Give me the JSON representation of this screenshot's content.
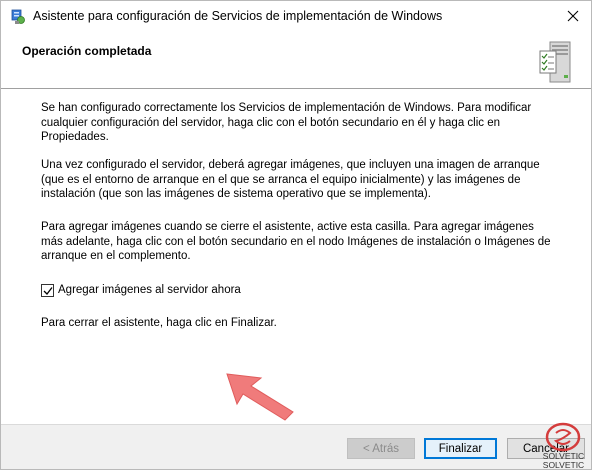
{
  "window": {
    "title": "Asistente para configuración de Servicios de implementación de Windows"
  },
  "header": {
    "title": "Operación completada",
    "icon": "server-checklist-icon"
  },
  "content": {
    "paragraph_1": "Se han configurado correctamente los Servicios de implementación de Windows. Para modificar cualquier configuración del servidor, haga clic con el botón secundario en él y haga clic en Propiedades.",
    "paragraph_2": "Una vez configurado el servidor, deberá agregar imágenes, que incluyen una imagen de arranque (que es el entorno de arranque en el que se arranca el equipo inicialmente) y las imágenes de instalación (que son las imágenes de sistema operativo que se implementa).",
    "paragraph_3": "Para agregar imágenes cuando se cierre el asistente, active esta casilla. Para agregar imágenes más adelante, haga clic con el botón secundario en el nodo Imágenes de instalación o Imágenes de arranque en el complemento.",
    "checkbox_label": "Agregar imágenes al servidor ahora",
    "checkbox_checked": true,
    "paragraph_4": "Para cerrar el asistente, haga clic en Finalizar."
  },
  "footer": {
    "back_label": "< Atrás",
    "finish_label": "Finalizar",
    "cancel_label": "Cancelar"
  },
  "watermark": {
    "line1": "SOLVETIC",
    "line2": "SOLVETIC"
  },
  "colors": {
    "accent": "#0078d7",
    "arrow": "#f07b7b"
  }
}
